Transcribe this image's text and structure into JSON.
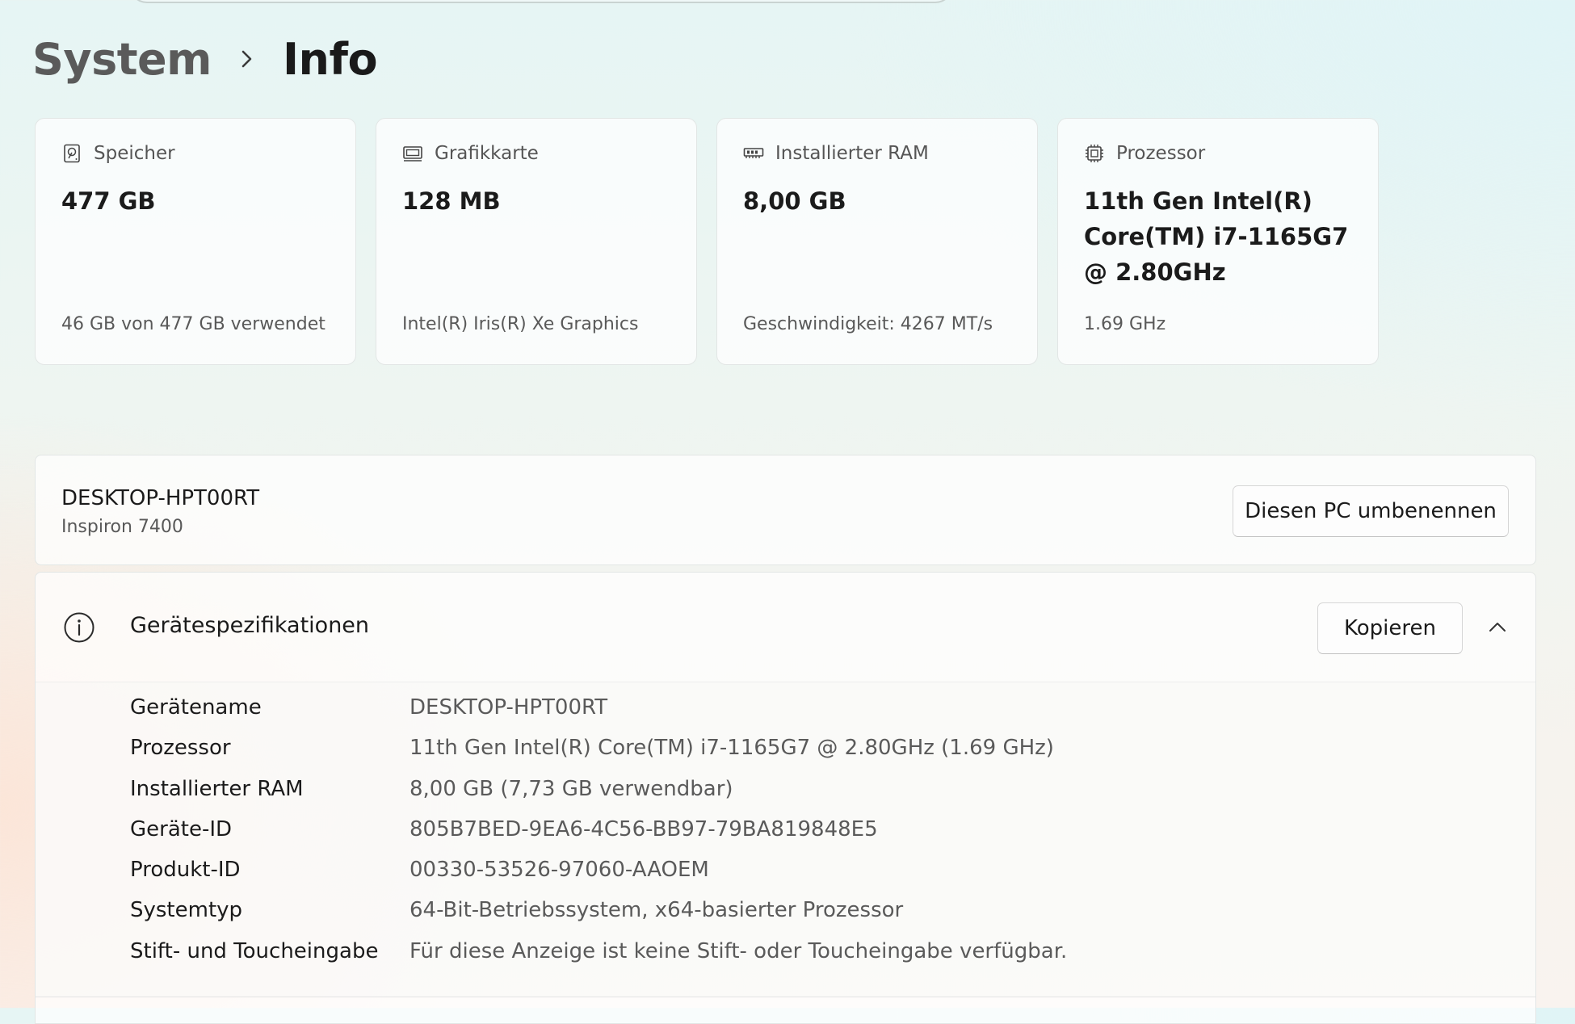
{
  "breadcrumb": {
    "parent": "System",
    "current": "Info"
  },
  "cards": [
    {
      "title": "Speicher",
      "icon": "storage-drive-icon",
      "value": "477 GB",
      "sub": "46 GB von 477 GB verwendet"
    },
    {
      "title": "Grafikkarte",
      "icon": "graphics-card-icon",
      "value": "128 MB",
      "sub": "Intel(R) Iris(R) Xe Graphics"
    },
    {
      "title": "Installierter RAM",
      "icon": "ram-icon",
      "value": "8,00 GB",
      "sub": "Geschwindigkeit: 4267 MT/s"
    },
    {
      "title": "Prozessor",
      "icon": "processor-icon",
      "value": "11th Gen Intel(R) Core(TM) i7-1165G7 @ 2.80GHz",
      "sub": "1.69 GHz"
    }
  ],
  "pc": {
    "name": "DESKTOP-HPT00RT",
    "model": "Inspiron 7400",
    "rename_label": "Diesen PC umbenennen"
  },
  "specs": {
    "title": "Gerätespezifikationen",
    "copy_label": "Kopieren",
    "rows": [
      {
        "label": "Gerätename",
        "value": "DESKTOP-HPT00RT"
      },
      {
        "label": "Prozessor",
        "value": "11th Gen Intel(R) Core(TM) i7-1165G7 @ 2.80GHz (1.69 GHz)"
      },
      {
        "label": "Installierter RAM",
        "value": "8,00 GB (7,73 GB verwendbar)"
      },
      {
        "label": "Geräte-ID",
        "value": "805B7BED-9EA6-4C56-BB97-79BA819848E5"
      },
      {
        "label": "Produkt-ID",
        "value": "00330-53526-97060-AAOEM"
      },
      {
        "label": "Systemtyp",
        "value": "64-Bit-Betriebssystem, x64-basierter Prozessor"
      },
      {
        "label": "Stift- und Toucheingabe",
        "value": "Für diese Anzeige ist keine Stift- oder Toucheingabe verfügbar."
      }
    ]
  }
}
